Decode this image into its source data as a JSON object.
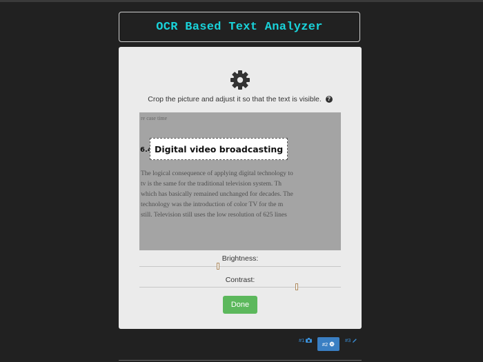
{
  "app": {
    "title": "OCR Based Text Analyzer"
  },
  "panel": {
    "icon": "gear-icon",
    "instruction": "Crop the picture and adjust it so that the text is visible.",
    "help_icon": "question-circle-icon",
    "image": {
      "top_text": "re case time",
      "heading_number": "6.4",
      "heading": "Digital video broadcasting",
      "body_lines": [
        "The logical consequence of applying digital technology to",
        "tv is the same for the traditional television system. Th",
        "which has basically remained unchanged for decades. The",
        "technology was the introduction of color TV for the m",
        "still. Television still uses the low resolution of 625 lines"
      ]
    },
    "brightness": {
      "label": "Brightness:",
      "value": 0.39
    },
    "contrast": {
      "label": "Contrast:",
      "value": 0.78
    },
    "done_label": "Done"
  },
  "steps": [
    {
      "label": "#1",
      "icon": "camera-icon",
      "active": false
    },
    {
      "label": "#2",
      "icon": "gear-icon",
      "active": true
    },
    {
      "label": "#3",
      "icon": "pencil-icon",
      "active": false
    }
  ],
  "colors": {
    "accent": "#19d3da",
    "done": "#5cb85c",
    "step_active": "#3a7fc3",
    "background": "#212121",
    "panel": "#ebebeb"
  }
}
